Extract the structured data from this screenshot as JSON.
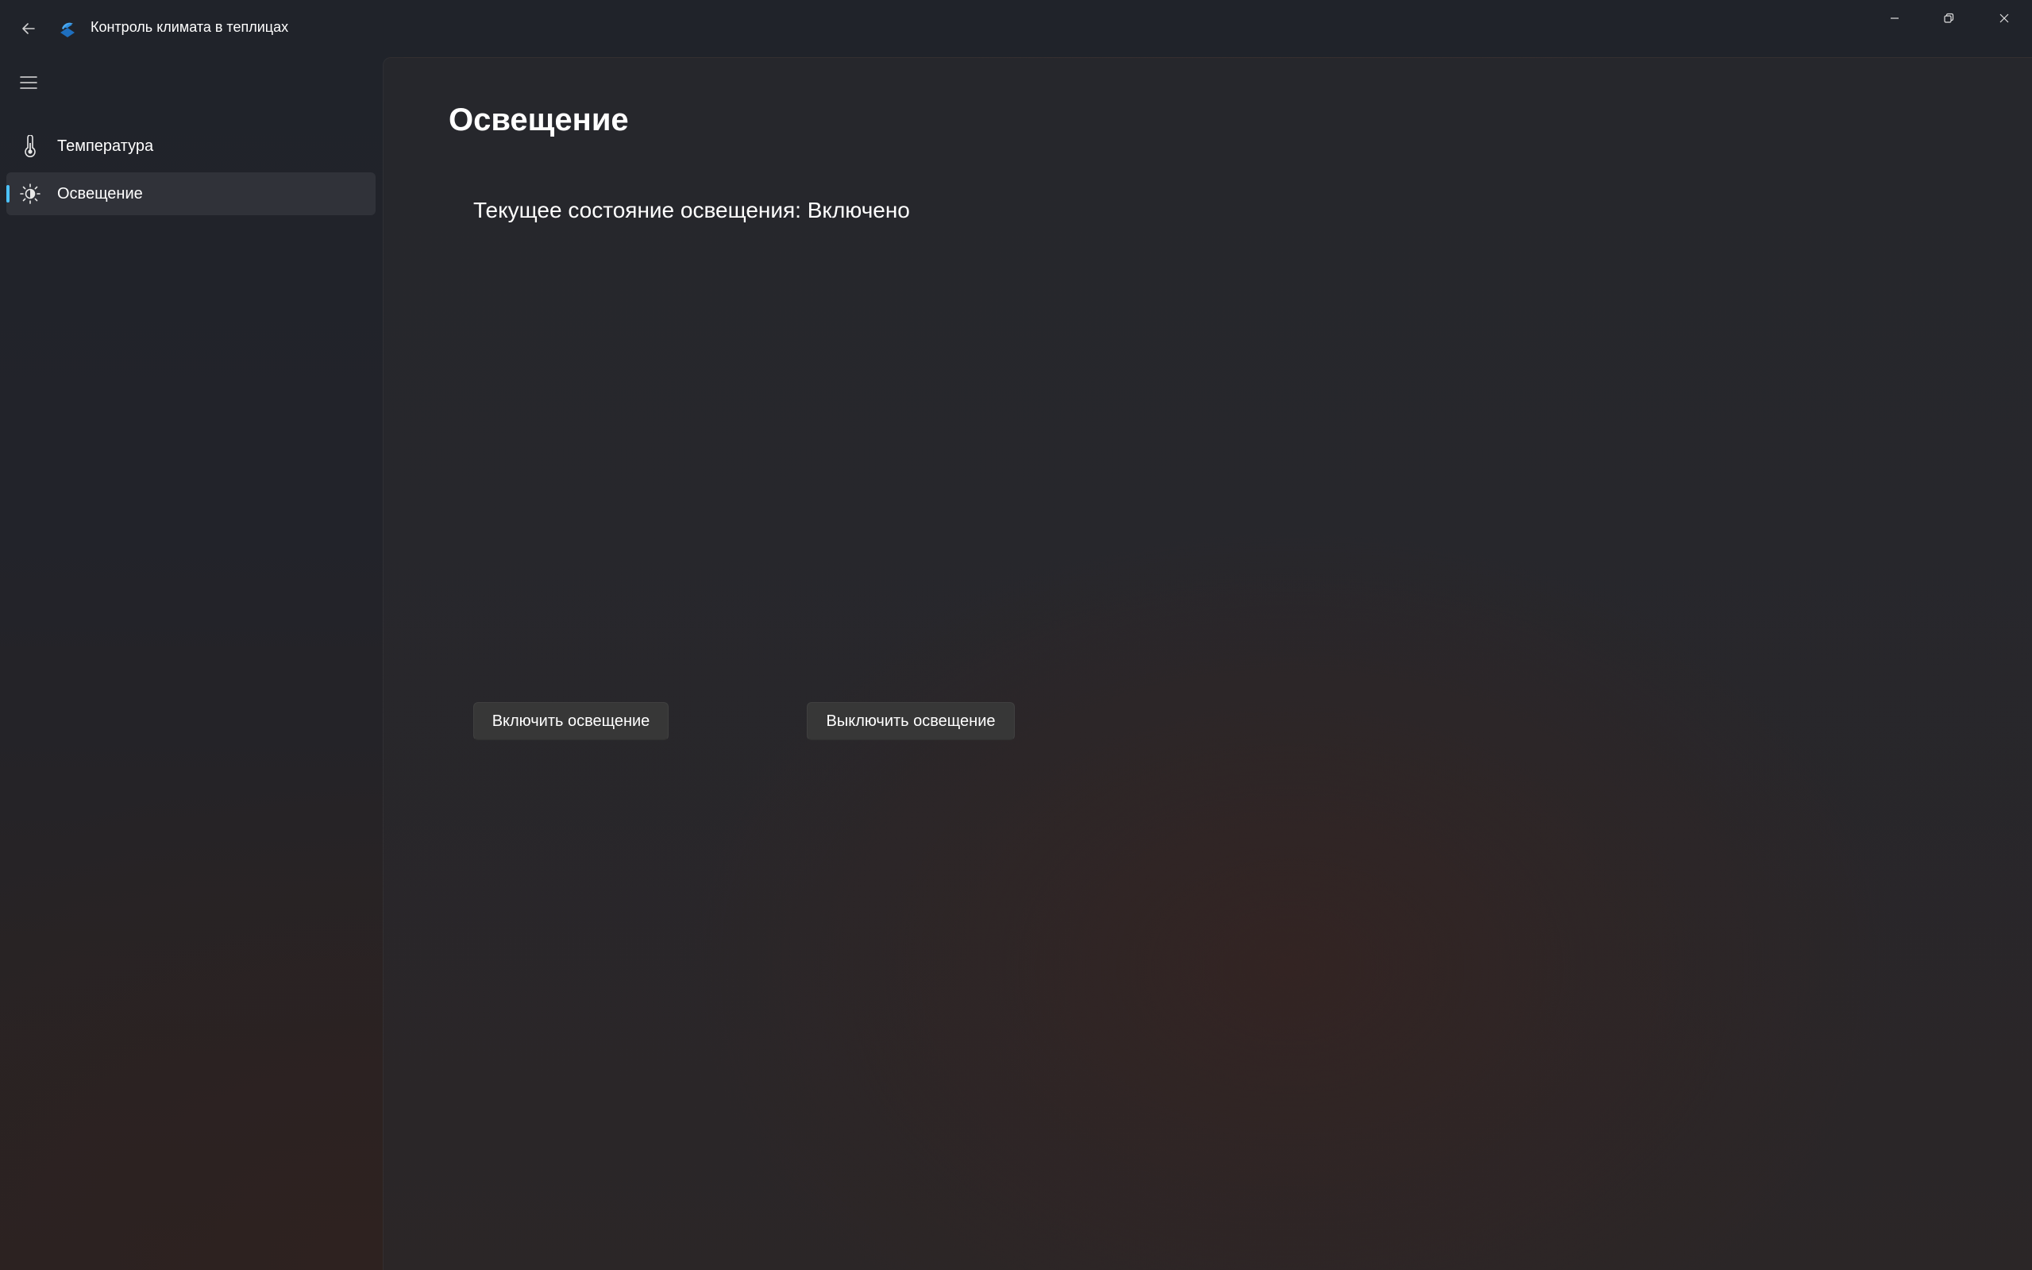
{
  "window": {
    "title": "Контроль климата в теплицах"
  },
  "titlebar": {
    "back_icon": "back-arrow-icon",
    "app_icon": "app-logo-icon",
    "minimize_icon": "minimize-icon",
    "restore_icon": "restore-icon",
    "close_icon": "close-icon"
  },
  "sidebar": {
    "menu_icon": "hamburger-menu-icon",
    "items": [
      {
        "label": "Температура",
        "icon": "thermometer-icon",
        "selected": false
      },
      {
        "label": "Освещение",
        "icon": "brightness-icon",
        "selected": true
      }
    ]
  },
  "main": {
    "page_title": "Освещение",
    "status_text": "Текущее состояние освещения: Включено",
    "turn_on_label": "Включить освещение",
    "turn_off_label": "Выключить освещение"
  },
  "colors": {
    "accent": "#4cc2ff",
    "app_icon_blue": "#2f8fe0"
  }
}
